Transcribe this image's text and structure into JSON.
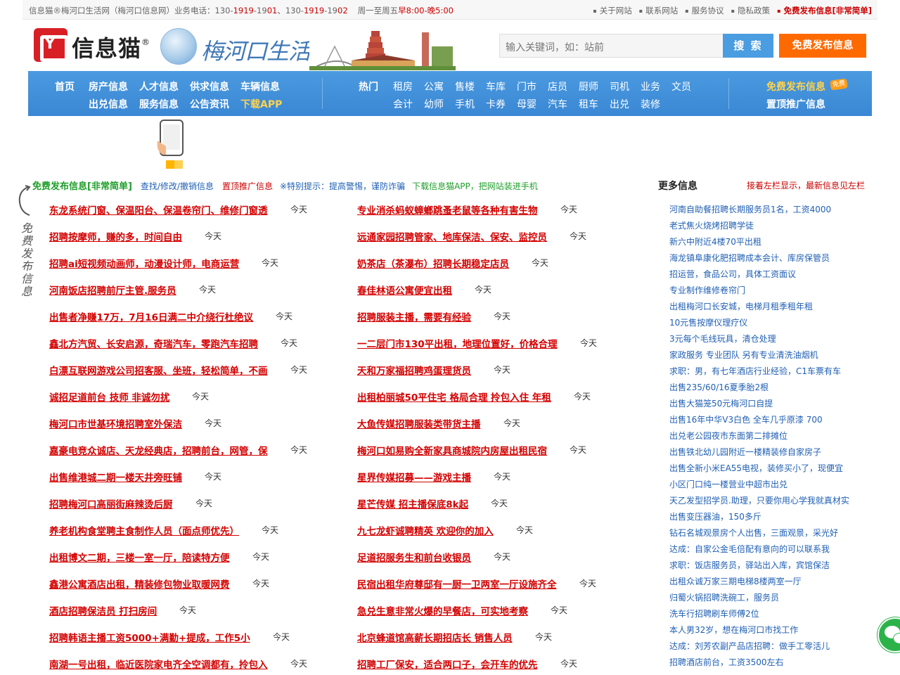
{
  "topbar": {
    "left_parts": [
      "信息猫®梅河口生活网（梅河口信息网）业务电话：130-",
      "1919",
      "-19",
      "01",
      "、130-",
      "1919",
      "-19",
      "02"
    ],
    "hours_prefix": "周一至周五",
    "hours": "早8:00-晚5:00",
    "links": [
      "关于网站",
      "联系网站",
      "服务协议",
      "隐私政策"
    ],
    "publish_link": "免费发布信息[非常简单]"
  },
  "header": {
    "logo_text": "信息猫",
    "logo_mark": "®",
    "site_name": "梅河口生活网",
    "search_placeholder": "输入关键词，如：站前",
    "search_button": "搜 索",
    "publish_button": "免费发布信息"
  },
  "nav": {
    "main_row1": [
      "首页",
      "房产信息",
      "人才信息",
      "供求信息",
      "车辆信息"
    ],
    "main_row2": [
      "出兑信息",
      "服务信息",
      "公告资讯",
      "下载APP"
    ],
    "hot_label": "热门",
    "hot_row1": [
      "租房",
      "公寓",
      "售楼",
      "车库",
      "门市",
      "店员",
      "厨师",
      "司机",
      "业务",
      "文员"
    ],
    "hot_row2": [
      "会计",
      "幼师",
      "手机",
      "卡券",
      "母婴",
      "汽车",
      "租车",
      "出兑",
      "装修"
    ],
    "free_publish": "免费发布信息",
    "free_badge": "免费",
    "top_promo": "置顶推广信息"
  },
  "info_bar": {
    "free": "免费发布信息[非常简单]",
    "find": "查找/修改/撤销信息",
    "top": "置顶推广信息",
    "tip": "※特别提示：提高警惕，谨防诈骗",
    "download": "下载信息猫APP，把网站装进手机"
  },
  "ribbon_text": "免费发布信息",
  "listings_left": [
    {
      "title": "东龙系统门窗、保温阳台、保温卷帘门、维修门窗透",
      "date": "今天"
    },
    {
      "title": "招聘按摩师，赚的多，时间自由",
      "date": "今天"
    },
    {
      "title": "招聘ai短视频动画师，动漫设计师，电商运营",
      "date": "今天"
    },
    {
      "title": "河南饭店招聘前厅主管.服务员",
      "date": "今天"
    },
    {
      "title": "出售者净赚17万，7月16日满二中介绕行杜绝议",
      "date": "今天"
    },
    {
      "title": "鑫北方汽贸、长安启源，奇瑞汽车，零跑汽车招聘",
      "date": "今天"
    },
    {
      "title": "白漂互联网游戏公司招客服、坐班，轻松简单，不画",
      "date": "今天"
    },
    {
      "title": "诚招足道前台 技师 非诚勿扰",
      "date": "今天"
    },
    {
      "title": "梅河口市世基环境招聘室外保洁",
      "date": "今天"
    },
    {
      "title": "嘉豪电竞众诚店、天龙经典店，招聘前台，网管，保",
      "date": "今天"
    },
    {
      "title": "出售维港城二期一楼天井旁旺铺",
      "date": "今天"
    },
    {
      "title": "招聘梅河口高丽街麻辣烫后厨",
      "date": "今天"
    },
    {
      "title": "养老机构食堂聘主食制作人员（面点师优先）",
      "date": "今天"
    },
    {
      "title": "出租博文二期，三楼一室一厅，陪读特方便",
      "date": "今天"
    },
    {
      "title": "鑫港公寓酒店出租，精装修包物业取暖网费",
      "date": "今天"
    },
    {
      "title": "酒店招聘保洁员 打扫房间",
      "date": "今天"
    },
    {
      "title": "招聘韩语主播工资5000+满勤+提成，工作5小",
      "date": "今天"
    },
    {
      "title": "南湖一号出租，临近医院家电齐全空调都有，拎包入",
      "date": "今天"
    }
  ],
  "listings_right": [
    {
      "title": "专业消杀蚂蚁蟑螂跳蚤老鼠等各种有害生物",
      "date": "今天"
    },
    {
      "title": "远通家园招聘管家、地库保洁、保安、监控员",
      "date": "今天"
    },
    {
      "title": "奶茶店（茶瀑布）招聘长期稳定店员",
      "date": "今天"
    },
    {
      "title": "春佳林语公寓便宜出租",
      "date": "今天"
    },
    {
      "title": "招聘服装主播，需要有经验",
      "date": "今天"
    },
    {
      "title": "一二层门市130平出租，地理位置好，价格合理",
      "date": "今天"
    },
    {
      "title": "天和万家福招聘鸡蛋理货员",
      "date": "今天"
    },
    {
      "title": "出租柏丽城50平住宅 格局合理 拎包入住 年租",
      "date": "今天"
    },
    {
      "title": "大鱼传媒招聘服装类带货主播",
      "date": "今天"
    },
    {
      "title": "梅河口如易购全新家具商城院内房屋出租民宿",
      "date": "今天"
    },
    {
      "title": "星界传媒招募——游戏主播",
      "date": "今天"
    },
    {
      "title": "星芒传媒 招主播保底8k起",
      "date": "今天"
    },
    {
      "title": "九七龙虾诚聘精英 欢迎你的加入",
      "date": "今天"
    },
    {
      "title": "足道招服务生和前台收银员",
      "date": "今天"
    },
    {
      "title": "民宿出租华府尊邸有一厨一卫两室一厅设施齐全",
      "date": "今天"
    },
    {
      "title": "急兑生意非常火爆的早餐店，可实地考察",
      "date": "今天"
    },
    {
      "title": "北京蜂道馆高薪长期招店长 销售人员",
      "date": "今天"
    },
    {
      "title": "招聘工厂保安，适合两口子，会开车的优先",
      "date": "今天"
    }
  ],
  "more": {
    "title": "更多信息",
    "note": "接着左栏显示，最新信息见左栏",
    "items": [
      "河南自助餐招聘长期服务员1名，工资4000",
      "老式焦火烧烤招聘学徒",
      "新六中附近4楼70平出租",
      "海龙镇阜康化肥招聘成本会计、库房保管员",
      "招运营，食品公司，具体工资面议",
      "专业制作维修卷帘门",
      "出租梅河口长安城，电梯月租季租年租",
      "10元售按摩仪理疗仪",
      "3元每个毛线玩具，清仓处理",
      "家政服务 专业团队 另有专业清洗油烟机",
      "求职：男，有七年酒店行业经验，C1车票有车",
      "出售235/60/16夏季胎2根",
      "出售大猫笼50元梅河口自提",
      "出售16年中华V3白色 全车几乎原漆 700",
      "出兑老公园夜市东面第二排摊位",
      "出售铁北幼儿园附近一楼精装修自家房子",
      "出售全新小米EA55电视，装修买小了，现便宜",
      "小区门口纯一楼营业中超市出兑",
      "天乙发型招学员.助理，只要你用心学我就真材实",
      "出售变压器油，150多斤",
      "钻石名城观景房个人出售，三面观景，采光好",
      "达成：自家公金毛倍配有意向的可以联系我",
      "求职：饭店服务员，驿站出入库，宾馆保洁",
      "出租众诚万家三期电梯8楼两室一厅",
      "归蜀火锅招聘洗碗工，服务员",
      "洗车行招聘刷车师傅2位",
      "本人男32岁，想在梅河口市找工作",
      "达成：刘芳农副产品店招聘：做手工零活儿",
      "招聘酒店前台，工资3500左右"
    ]
  },
  "colors": {
    "nav_blue": "#3a87d4",
    "title_red": "#d40000",
    "link_blue": "#1f5fb4",
    "accent_orange": "#ff6a00",
    "green": "#1f9e2a"
  }
}
